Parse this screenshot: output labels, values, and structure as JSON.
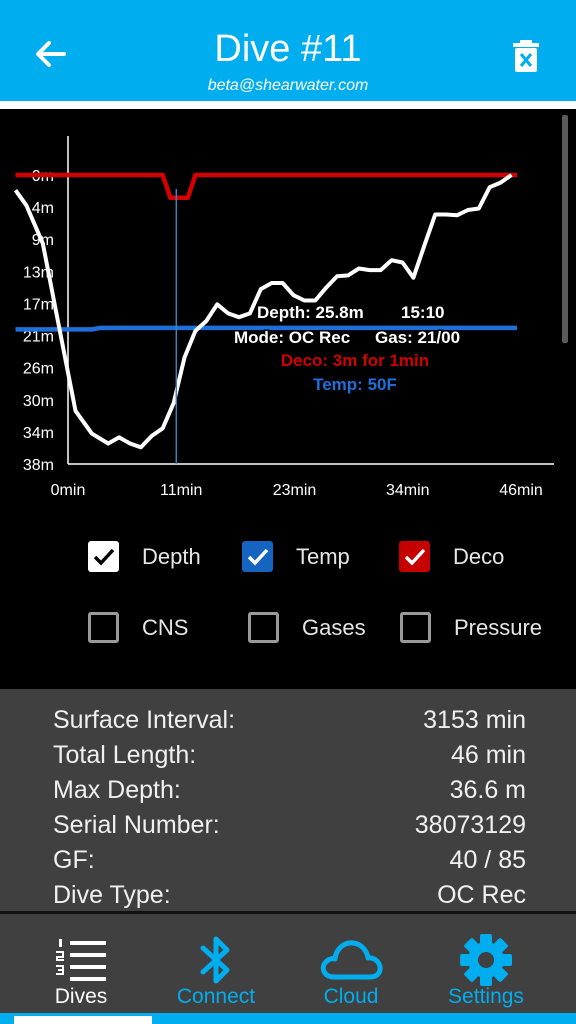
{
  "header": {
    "title": "Dive #11",
    "subtitle": "beta@shearwater.com",
    "back_icon": "arrow-left-icon",
    "delete_icon": "trash-icon",
    "bg_color": "#00aeef"
  },
  "chart_data": {
    "type": "line",
    "xlabel": "",
    "ylabel": "",
    "x_ticks": [
      "0min",
      "11min",
      "23min",
      "34min",
      "46min"
    ],
    "y_ticks": [
      "0m",
      "4m",
      "9m",
      "13m",
      "17m",
      "21m",
      "26m",
      "30m",
      "34m",
      "38m"
    ],
    "xlim": [
      0,
      46
    ],
    "ylim": [
      38,
      0
    ],
    "grid": false,
    "series": [
      {
        "name": "Depth",
        "color": "#ffffff",
        "x": [
          0,
          1,
          2.5,
          4,
          5.5,
          7,
          8.5,
          9.5,
          10.5,
          11.5,
          12.5,
          13.5,
          14.5,
          15.5,
          16.5,
          17.5,
          18.5,
          19.5,
          20.5,
          21.5,
          22.5,
          23.5,
          24.5,
          25.5,
          26.5,
          27.5,
          28.5,
          29.5,
          30.5,
          31.5,
          32.5,
          33.5,
          34.5,
          35.5,
          36.5,
          37.5,
          38.5,
          39.5,
          40.5,
          41.5,
          42.5,
          43.5,
          44.5,
          45.5
        ],
        "y": [
          2,
          4,
          9,
          20,
          31,
          34,
          35.3,
          34.5,
          35.3,
          35.8,
          34.3,
          33.3,
          30,
          24,
          20.5,
          19.2,
          17,
          18.2,
          18.7,
          18.2,
          15,
          14.2,
          14.2,
          15.8,
          16.5,
          16.5,
          14.8,
          13.3,
          13.2,
          12.3,
          12.5,
          12.5,
          11.2,
          11.5,
          13.5,
          9.3,
          5.2,
          5.2,
          5.3,
          4.6,
          4.4,
          1.6,
          1,
          0
        ]
      },
      {
        "name": "Temp",
        "color": "#1e6fd9",
        "x": [
          0,
          7,
          7.8,
          46
        ],
        "y": [
          20.3,
          20.3,
          20.1,
          20.1
        ]
      },
      {
        "name": "Deco",
        "color": "#d40000",
        "x": [
          0,
          13.5,
          14.2,
          15.8,
          16.5,
          46
        ],
        "y": [
          0,
          0,
          3,
          3,
          0,
          0
        ]
      }
    ],
    "cursor": {
      "x": 14.2,
      "depth_text": "Depth: 25.8m",
      "time_text": "15:10",
      "mode_text": "Mode: OC Rec",
      "gas_text": "Gas: 21/00",
      "deco_text": "Deco: 3m for 1min",
      "temp_text": "Temp: 50F"
    }
  },
  "checkboxes": [
    {
      "label": "Depth",
      "checked": true,
      "color": "#ffffff"
    },
    {
      "label": "Temp",
      "checked": true,
      "color": "#1565c0"
    },
    {
      "label": "Deco",
      "checked": true,
      "color": "#c60000"
    },
    {
      "label": "CNS",
      "checked": false
    },
    {
      "label": "Gases",
      "checked": false
    },
    {
      "label": "Pressure",
      "checked": false
    }
  ],
  "stats": [
    {
      "label": "Surface Interval:",
      "value": "3153 min"
    },
    {
      "label": "Total Length:",
      "value": "46 min"
    },
    {
      "label": "Max Depth:",
      "value": "36.6 m"
    },
    {
      "label": "Serial Number:",
      "value": "38073129"
    },
    {
      "label": "GF:",
      "value": "40 / 85"
    },
    {
      "label": "Dive Type:",
      "value": "OC Rec"
    }
  ],
  "nav": {
    "items": [
      {
        "label": "Dives",
        "icon": "dive-list-icon",
        "active": true
      },
      {
        "label": "Connect",
        "icon": "bluetooth-icon",
        "active": false
      },
      {
        "label": "Cloud",
        "icon": "cloud-icon",
        "active": false
      },
      {
        "label": "Settings",
        "icon": "gear-icon",
        "active": false
      }
    ],
    "accent_color": "#00aeef"
  }
}
